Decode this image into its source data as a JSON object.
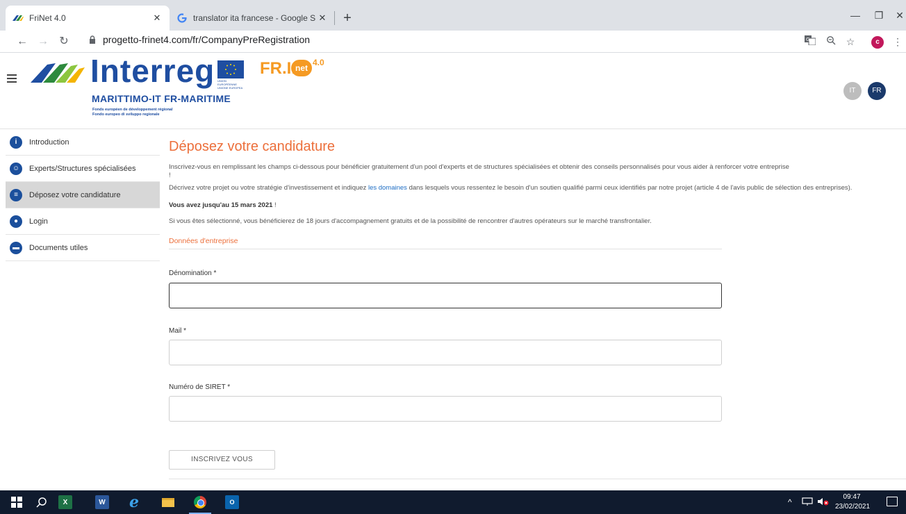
{
  "browser": {
    "tabs": [
      {
        "title": "FriNet 4.0",
        "favicon": "frinet-wings-icon"
      },
      {
        "title": "translator ita francese - Google S",
        "favicon": "google-g-icon"
      }
    ],
    "url": "progetto-frinet4.com/fr/CompanyPreRegistration",
    "profile_initial": "c"
  },
  "header": {
    "logo_main": "Interreg",
    "logo_sub": "MARITTIMO-IT FR-MARITIME",
    "logo_fonds_fr": "Fonds européen de développement régional",
    "logo_fonds_it": "Fondo europeo di sviluppo regionale",
    "eu_text": "UNION EUROPÉENNE UNIONE EUROPEA",
    "frinet_text": "FR.I.",
    "frinet_net": "net",
    "frinet_version": "4.0",
    "lang_it": "IT",
    "lang_fr": "FR"
  },
  "sidebar": {
    "items": [
      {
        "label": "Introduction",
        "icon": "i",
        "active": false
      },
      {
        "label": "Experts/Structures spécialisées",
        "icon": "☺",
        "active": false
      },
      {
        "label": "Déposez votre candidature",
        "icon": "≡",
        "active": true
      },
      {
        "label": "Login",
        "icon": "●",
        "active": false
      },
      {
        "label": "Documents utiles",
        "icon": "▬",
        "active": false
      }
    ]
  },
  "main": {
    "title": "Déposez votre candidature",
    "intro": "Inscrivez-vous en remplissant les champs ci-dessous pour bénéficier gratuitement d'un pool d'experts et de structures spécialisées et obtenir des conseils personnalisés pour vous aider à renforcer votre entreprise",
    "intro_end": "!",
    "desc_before": "Décrivez votre projet ou votre stratégie d'investissement et indiquez ",
    "desc_link": "les domaines",
    "desc_after": " dans lesquels vous ressentez le besoin d'un soutien qualifié parmi ceux identifiés par notre projet (article 4 de l'avis public de sélection des entreprises).",
    "deadline_bold": "Vous avez jusqu'au 15 mars 2021",
    "deadline_end": " !",
    "selection": "Si vous êtes sélectionné, vous bénéficierez de 18 jours d'accompagnement gratuits et de la possibilité de rencontrer d'autres opérateurs sur le marché transfrontalier.",
    "section_title": "Données d'entreprise",
    "fields": [
      {
        "label": "Dénomination *",
        "value": ""
      },
      {
        "label": "Mail *",
        "value": ""
      },
      {
        "label": "Numéro de SIRET *",
        "value": ""
      }
    ],
    "submit_label": "INSCRIVEZ VOUS"
  },
  "taskbar": {
    "time": "09:47",
    "date": "23/02/2021"
  }
}
